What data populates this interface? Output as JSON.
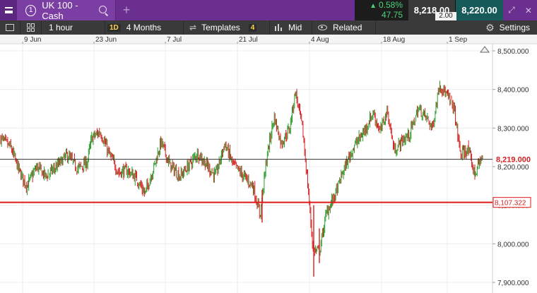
{
  "header": {
    "menu_icon": "hamburger-menu-icon",
    "instrument_number": "1",
    "instrument_name": "UK 100 - Cash",
    "add_tab": "+",
    "change_pct": "0.58%",
    "change_abs": "47.75",
    "sell_price": "8,218.00",
    "buy_price": "8,220.00",
    "spread": "2.00",
    "expand_icon": "expand-arrows-icon",
    "close_icon": "close-icon"
  },
  "toolbar": {
    "interval": "1 hour",
    "type_badge": "1D",
    "range": "4 Months",
    "templates": "Templates",
    "templates_badge": "4",
    "price_mode": "Mid",
    "related": "Related",
    "settings": "Settings"
  },
  "colors": {
    "brand_purple": "#6a2f8f",
    "up": "#2a9d2a",
    "down": "#d62020",
    "current_price_line": "#333333",
    "alert_line": "#e01a1a"
  },
  "chart_data": {
    "type": "candlestick",
    "x_tick_labels": [
      "9 Jun",
      "23 Jun",
      "7 Jul",
      "21 Jul",
      "4 Aug",
      "18 Aug",
      "1 Sep"
    ],
    "y_tick_labels": [
      "7,900.000",
      "8,000.000",
      "8,100.000",
      "8,200.000",
      "8,300.000",
      "8,400.000",
      "8,500.000"
    ],
    "y_ticks": [
      7900,
      8000,
      8100,
      8200,
      8300,
      8400,
      8500
    ],
    "ylim": [
      7895,
      8533
    ],
    "current_price": 8219.0,
    "current_price_label": "8,219.000",
    "alert_price": 8107.322,
    "alert_price_label": "8,107.322",
    "series_close_anchors": [
      [
        0,
        8275
      ],
      [
        15,
        8250
      ],
      [
        28,
        8185
      ],
      [
        38,
        8150
      ],
      [
        52,
        8200
      ],
      [
        65,
        8175
      ],
      [
        80,
        8200
      ],
      [
        95,
        8230
      ],
      [
        110,
        8195
      ],
      [
        123,
        8210
      ],
      [
        130,
        8275
      ],
      [
        142,
        8290
      ],
      [
        155,
        8230
      ],
      [
        168,
        8185
      ],
      [
        180,
        8190
      ],
      [
        193,
        8170
      ],
      [
        205,
        8130
      ],
      [
        218,
        8200
      ],
      [
        228,
        8265
      ],
      [
        240,
        8205
      ],
      [
        255,
        8175
      ],
      [
        268,
        8205
      ],
      [
        280,
        8235
      ],
      [
        292,
        8205
      ],
      [
        305,
        8175
      ],
      [
        318,
        8260
      ],
      [
        330,
        8205
      ],
      [
        345,
        8175
      ],
      [
        358,
        8150
      ],
      [
        368,
        8075
      ],
      [
        378,
        8230
      ],
      [
        388,
        8330
      ],
      [
        398,
        8260
      ],
      [
        410,
        8300
      ],
      [
        418,
        8395
      ],
      [
        428,
        8300
      ],
      [
        436,
        8145
      ],
      [
        443,
        7985
      ],
      [
        452,
        7980
      ],
      [
        462,
        8080
      ],
      [
        475,
        8130
      ],
      [
        485,
        8185
      ],
      [
        500,
        8250
      ],
      [
        515,
        8290
      ],
      [
        528,
        8340
      ],
      [
        538,
        8290
      ],
      [
        548,
        8345
      ],
      [
        558,
        8240
      ],
      [
        568,
        8265
      ],
      [
        580,
        8285
      ],
      [
        592,
        8350
      ],
      [
        602,
        8330
      ],
      [
        612,
        8300
      ],
      [
        622,
        8415
      ],
      [
        632,
        8385
      ],
      [
        642,
        8355
      ],
      [
        652,
        8230
      ],
      [
        662,
        8245
      ],
      [
        672,
        8180
      ],
      [
        680,
        8220
      ]
    ]
  }
}
